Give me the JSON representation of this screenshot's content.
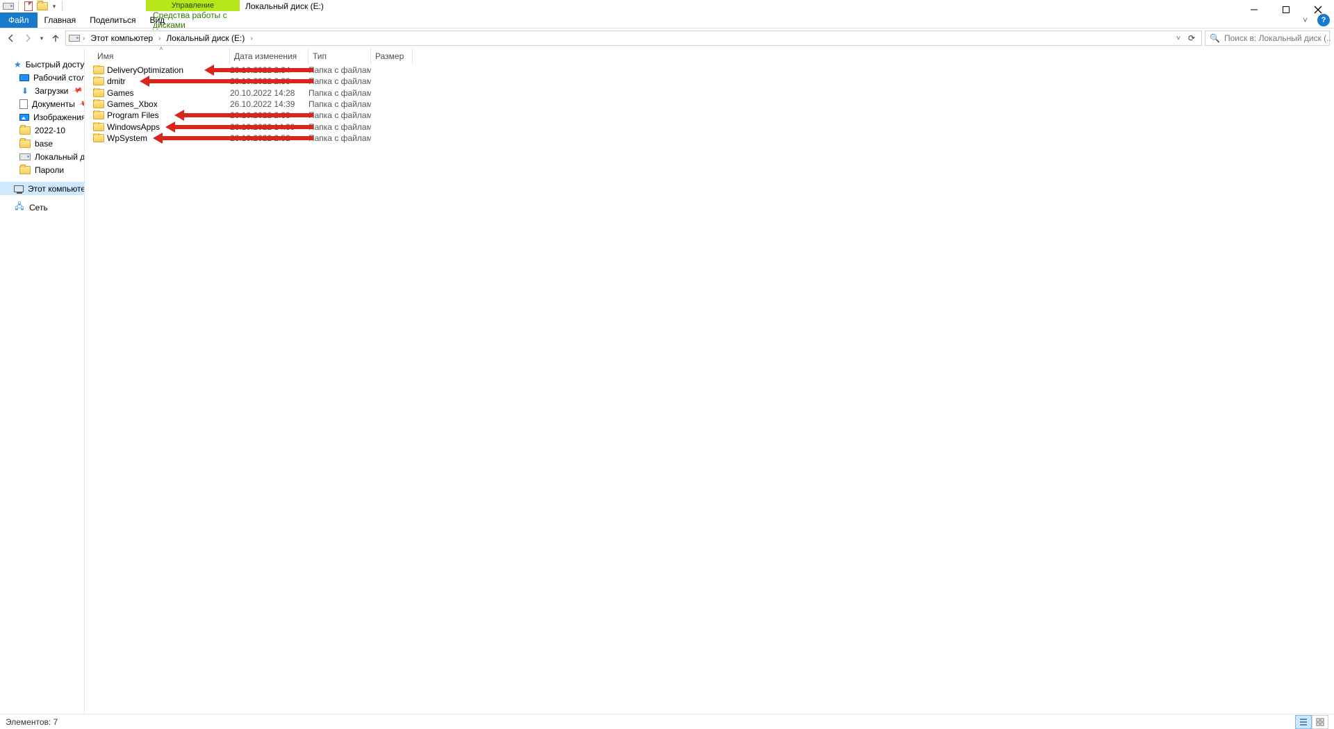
{
  "window": {
    "title": "Локальный диск (E:)",
    "context_tab": "Управление"
  },
  "ribbon": {
    "file": "Файл",
    "home": "Главная",
    "share": "Поделиться",
    "view": "Вид",
    "tools": "Средства работы с дисками",
    "drop_hint": "˅"
  },
  "address": {
    "crumb1": "Этот компьютер",
    "crumb2": "Локальный диск (E:)"
  },
  "search": {
    "placeholder": "Поиск в: Локальный диск (..."
  },
  "navpane": {
    "quick": "Быстрый доступ",
    "desktop": "Рабочий стол",
    "downloads": "Загрузки",
    "documents": "Документы",
    "pictures": "Изображения",
    "f1": "2022-10",
    "f2": "base",
    "f3": "Локальный диск (C",
    "f4": "Пароли",
    "thispc": "Этот компьютер",
    "network": "Сеть"
  },
  "columns": {
    "name": "Имя",
    "date": "Дата изменения",
    "type": "Тип",
    "size": "Размер"
  },
  "rows": [
    {
      "name": "DeliveryOptimization",
      "date": "26.10.2022 2:34",
      "type": "Папка с файлами",
      "arrow": true
    },
    {
      "name": "dmitr",
      "date": "26.10.2022 2:33",
      "type": "Папка с файлами",
      "arrow": true
    },
    {
      "name": "Games",
      "date": "20.10.2022 14:28",
      "type": "Папка с файлами",
      "arrow": false
    },
    {
      "name": "Games_Xbox",
      "date": "26.10.2022 14:39",
      "type": "Папка с файлами",
      "arrow": false
    },
    {
      "name": "Program Files",
      "date": "26.10.2022 2:33",
      "type": "Папка с файлами",
      "arrow": true
    },
    {
      "name": "WindowsApps",
      "date": "26.10.2022 14:39",
      "type": "Папка с файлами",
      "arrow": true
    },
    {
      "name": "WpSystem",
      "date": "26.10.2022 2:52",
      "type": "Папка с файлами",
      "arrow": true
    }
  ],
  "status": {
    "text": "Элементов: 7"
  }
}
